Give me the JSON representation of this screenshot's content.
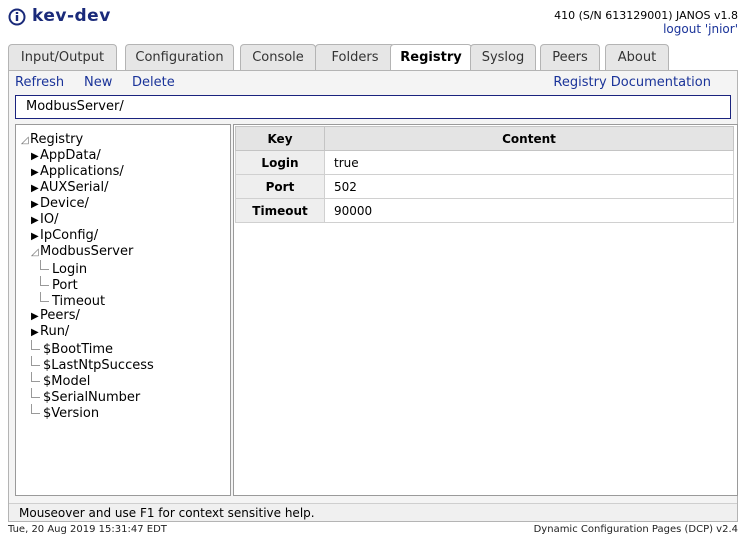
{
  "header": {
    "title": "kev-dev",
    "device_info": "410 (S/N 613129001) JANOS v1.8",
    "logout": "logout 'jnior'",
    "logo_icon": "info-circle-icon"
  },
  "tabs": [
    {
      "label": "Input/Output"
    },
    {
      "label": "Configuration"
    },
    {
      "label": "Console"
    },
    {
      "label": "Folders"
    },
    {
      "label": "Registry",
      "active": true
    },
    {
      "label": "Syslog"
    },
    {
      "label": "Peers"
    },
    {
      "label": "About"
    }
  ],
  "toolbar": {
    "refresh": "Refresh",
    "new": "New",
    "delete": "Delete",
    "docs": "Registry Documentation"
  },
  "path": "ModbusServer/",
  "tree": {
    "root": "Registry",
    "items": [
      {
        "label": "AppData/"
      },
      {
        "label": "Applications/"
      },
      {
        "label": "AUXSerial/"
      },
      {
        "label": "Device/"
      },
      {
        "label": "IO/"
      },
      {
        "label": "IpConfig/"
      },
      {
        "label": "ModbusServer",
        "children": [
          "Login",
          "Port",
          "Timeout"
        ]
      },
      {
        "label": "Peers/"
      },
      {
        "label": "Run/"
      }
    ],
    "leaves": [
      "$BootTime",
      "$LastNtpSuccess",
      "$Model",
      "$SerialNumber",
      "$Version"
    ]
  },
  "table": {
    "headers": [
      "Key",
      "Content"
    ],
    "rows": [
      {
        "key": "Login",
        "value": "true"
      },
      {
        "key": "Port",
        "value": "502"
      },
      {
        "key": "Timeout",
        "value": "90000"
      }
    ]
  },
  "help": "Mouseover and use F1 for context sensitive help.",
  "footer": {
    "timestamp": "Tue, 20 Aug 2019 15:31:47 EDT",
    "version": "Dynamic Configuration Pages (DCP) v2.4"
  },
  "colors": {
    "accent": "#1a3399",
    "title": "#1a2a7a",
    "path_border": "#1a237e"
  }
}
